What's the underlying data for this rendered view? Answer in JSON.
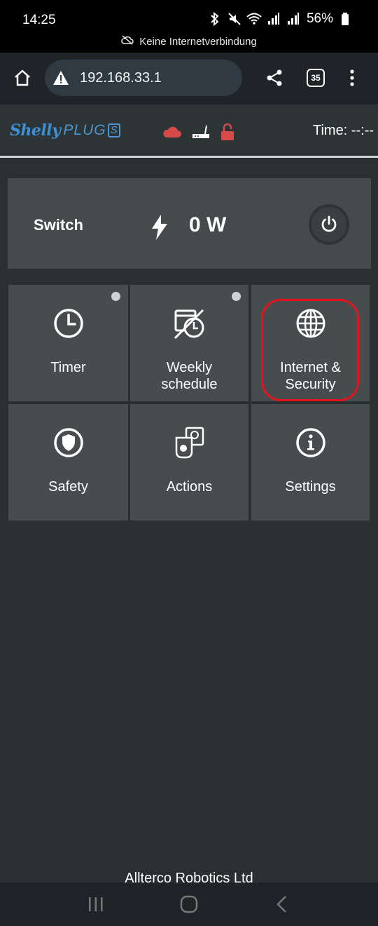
{
  "status_bar": {
    "time": "14:25",
    "battery": "56%",
    "offline_notice": "Keine Internetverbindung",
    "icons": [
      "bluetooth-icon",
      "mute-icon",
      "wifi-icon",
      "signal-icon",
      "signal-icon",
      "battery-icon"
    ]
  },
  "browser": {
    "url": "192.168.33.1",
    "tab_count": "35"
  },
  "header": {
    "logo_brand": "Shelly",
    "logo_product": "PLUG",
    "logo_suffix": "S",
    "time_label": "Time: --:--",
    "status_icons": [
      "cloud-icon",
      "router-icon",
      "unlocked-icon"
    ],
    "colors": {
      "cloud": "#d64a4a",
      "lock": "#d64a4a"
    }
  },
  "switch": {
    "label": "Switch",
    "power": "0 W"
  },
  "tiles": [
    {
      "label_line1": "Timer",
      "label_line2": "",
      "icon": "clock-icon",
      "dot": true
    },
    {
      "label_line1": "Weekly",
      "label_line2": "schedule",
      "icon": "schedule-icon",
      "dot": true
    },
    {
      "label_line1": "Internet &",
      "label_line2": "Security",
      "icon": "globe-icon",
      "dot": false,
      "highlighted": true
    },
    {
      "label_line1": "Safety",
      "label_line2": "",
      "icon": "shield-icon",
      "dot": false
    },
    {
      "label_line1": "Actions",
      "label_line2": "",
      "icon": "actions-icon",
      "dot": false
    },
    {
      "label_line1": "Settings",
      "label_line2": "",
      "icon": "info-icon",
      "dot": false
    }
  ],
  "footer": "Allterco Robotics Ltd",
  "colors": {
    "page_bg": "#2a2f31",
    "tile_bg": "#474c4e",
    "highlight": "#e3141b",
    "brand_blue": "#3e8fd6"
  }
}
